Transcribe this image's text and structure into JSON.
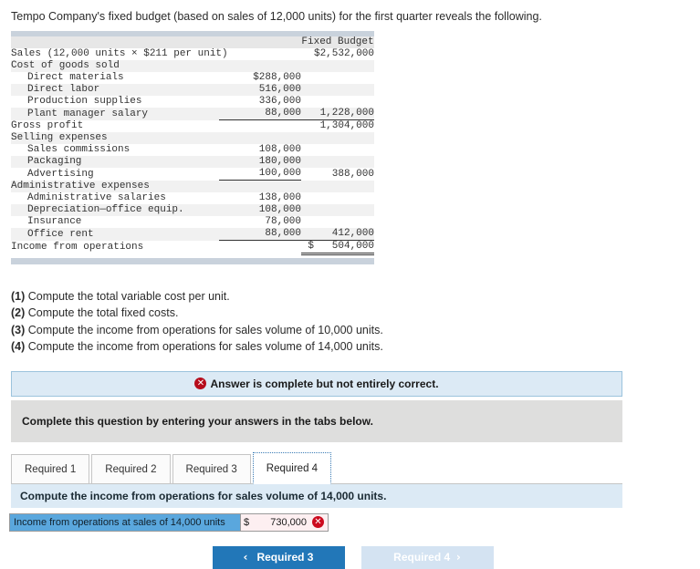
{
  "intro": "Tempo Company's fixed budget (based on sales of 12,000 units) for the first quarter reveals the following.",
  "budget": {
    "header": {
      "blank": "",
      "col_mid": "",
      "col_right": "Fixed Budget"
    },
    "rows": [
      {
        "label": "Sales (12,000 units × $211 per unit)",
        "indent": 0,
        "mid": "",
        "right": "$2,532,000"
      },
      {
        "label": "Cost of goods sold",
        "indent": 0,
        "mid": "",
        "right": ""
      },
      {
        "label": "Direct materials",
        "indent": 1,
        "mid": "$288,000",
        "right": ""
      },
      {
        "label": "Direct labor",
        "indent": 1,
        "mid": "516,000",
        "right": ""
      },
      {
        "label": "Production supplies",
        "indent": 1,
        "mid": "336,000",
        "right": ""
      },
      {
        "label": "Plant manager salary",
        "indent": 1,
        "mid": "88,000",
        "right": "1,228,000",
        "mid_rule": true,
        "right_rule": true
      },
      {
        "label": "Gross profit",
        "indent": 0,
        "mid": "",
        "right": "1,304,000"
      },
      {
        "label": "Selling expenses",
        "indent": 0,
        "mid": "",
        "right": ""
      },
      {
        "label": "Sales commissions",
        "indent": 1,
        "mid": "108,000",
        "right": ""
      },
      {
        "label": "Packaging",
        "indent": 1,
        "mid": "180,000",
        "right": ""
      },
      {
        "label": "Advertising",
        "indent": 1,
        "mid": "100,000",
        "right": "388,000",
        "mid_rule": true
      },
      {
        "label": "Administrative expenses",
        "indent": 0,
        "mid": "",
        "right": ""
      },
      {
        "label": "Administrative salaries",
        "indent": 1,
        "mid": "138,000",
        "right": ""
      },
      {
        "label": "Depreciation—office equip.",
        "indent": 1,
        "mid": "108,000",
        "right": ""
      },
      {
        "label": "Insurance",
        "indent": 1,
        "mid": "78,000",
        "right": ""
      },
      {
        "label": "Office rent",
        "indent": 1,
        "mid": "88,000",
        "right": "412,000",
        "mid_rule": true,
        "right_rule": true
      },
      {
        "label": "Income from operations",
        "indent": 0,
        "mid": "",
        "right": "$   504,000",
        "right_double": true
      }
    ]
  },
  "requirements": [
    {
      "num": "(1)",
      "text": "Compute the total variable cost per unit."
    },
    {
      "num": "(2)",
      "text": "Compute the total fixed costs."
    },
    {
      "num": "(3)",
      "text": "Compute the income from operations for sales volume of 10,000 units."
    },
    {
      "num": "(4)",
      "text": "Compute the income from operations for sales volume of 14,000 units."
    }
  ],
  "alert": {
    "icon": "error-x-icon",
    "text": "Answer is complete but not entirely correct."
  },
  "instruction": "Complete this question by entering your answers in the tabs below.",
  "tabs": [
    {
      "label": "Required 1",
      "active": false
    },
    {
      "label": "Required 2",
      "active": false
    },
    {
      "label": "Required 3",
      "active": false
    },
    {
      "label": "Required 4",
      "active": true
    }
  ],
  "question": "Compute the income from operations for sales volume of 14,000 units.",
  "answer": {
    "label": "Income from operations at sales of 14,000 units",
    "currency": "$",
    "value": "730,000",
    "status_icon": "✕"
  },
  "nav": {
    "prev_label": "Required 3",
    "prev_chevron": "‹",
    "next_label": "Required 4",
    "next_chevron": "›"
  },
  "colors": {
    "accent_blue": "#2277b8",
    "alert_blue": "#dceaf5",
    "error_red": "#cc0a1e",
    "label_blue": "#5aa7dd"
  }
}
